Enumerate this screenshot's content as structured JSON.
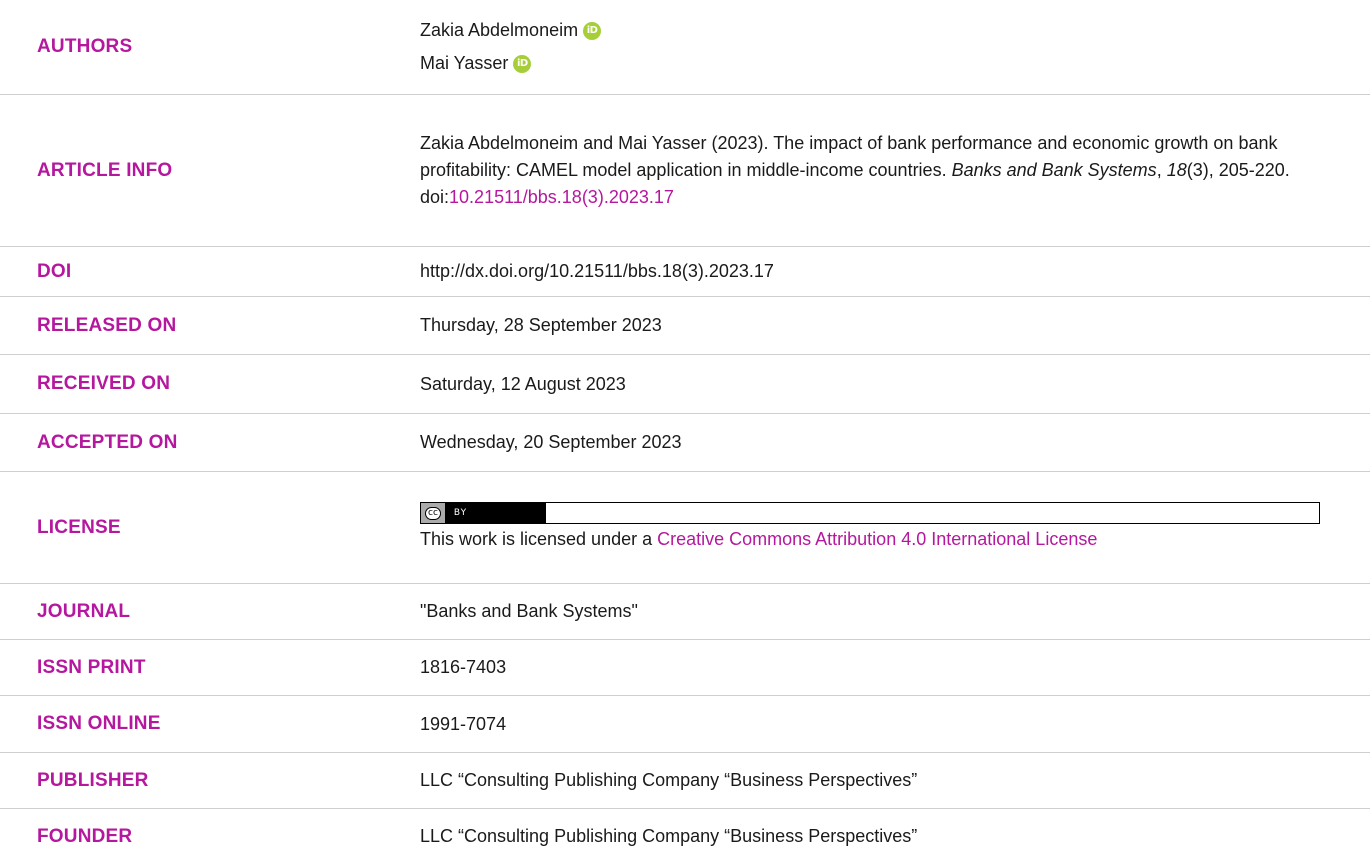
{
  "rows": {
    "authors": {
      "label": "AUTHORS",
      "names": [
        "Zakia Abdelmoneim",
        "Mai Yasser"
      ],
      "icon": "orcid-icon"
    },
    "article_info": {
      "label": "ARTICLE INFO",
      "text_prefix": "Zakia Abdelmoneim and Mai Yasser (2023). The impact of bank performance and economic growth on bank profitability: CAMEL model application in middle-income countries. ",
      "journal_italic": "Banks and Bank Systems",
      "comma": ", ",
      "volume_italic": "18",
      "text_suffix": "(3), 205-220.",
      "doi_prefix": "doi:",
      "doi_link": "10.21511/bbs.18(3).2023.17"
    },
    "doi": {
      "label": "DOI",
      "value": "http://dx.doi.org/10.21511/bbs.18(3).2023.17"
    },
    "released_on": {
      "label": "RELEASED ON",
      "value": "Thursday, 28 September 2023"
    },
    "received_on": {
      "label": "RECEIVED ON",
      "value": "Saturday, 12 August 2023"
    },
    "accepted_on": {
      "label": "ACCEPTED ON",
      "value": "Wednesday, 20 September 2023"
    },
    "license": {
      "label": "LICENSE",
      "badge_left": "cc",
      "badge_right": "BY",
      "text": "This work is licensed under a ",
      "link": "Creative Commons Attribution 4.0 International License"
    },
    "journal": {
      "label": "JOURNAL",
      "value": "\"Banks and Bank Systems\""
    },
    "issn_print": {
      "label": "ISSN PRINT",
      "value": "1816-7403"
    },
    "issn_online": {
      "label": "ISSN ONLINE",
      "value": "1991-7074"
    },
    "publisher": {
      "label": "PUBLISHER",
      "value": "LLC “Consulting Publishing Company “Business Perspectives”"
    },
    "founder": {
      "label": "FOUNDER",
      "value": "LLC “Consulting Publishing Company “Business Perspectives”"
    }
  },
  "colors": {
    "label": "#b5179e",
    "link": "#b5179e",
    "orcid": "#a6ce39",
    "divider": "#cfcfcf"
  }
}
